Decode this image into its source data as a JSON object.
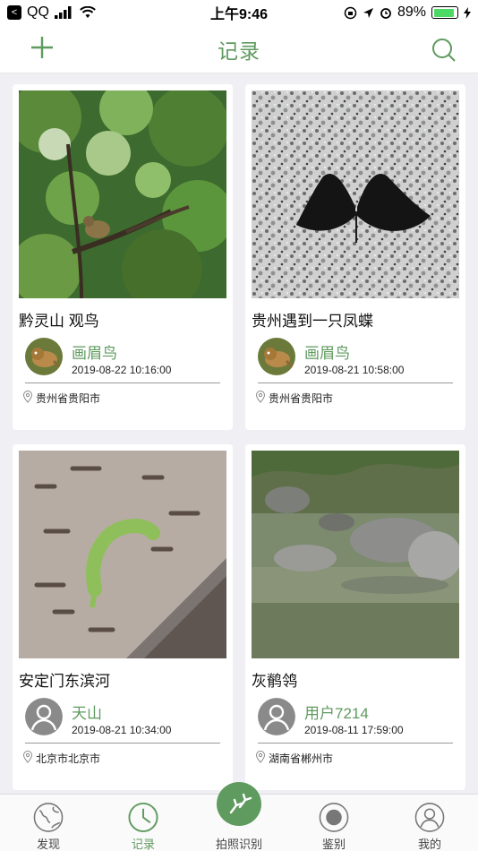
{
  "status_bar": {
    "back_label": "<",
    "app": "QQ",
    "time": "上午9:46",
    "battery": "89%",
    "battery_level": 0.89
  },
  "header": {
    "title": "记录",
    "add_icon": "plus-icon",
    "search_icon": "search-icon"
  },
  "records": [
    {
      "title": "黔灵山 观鸟",
      "user": "画眉鸟",
      "time": "2019-08-22 10:16:00",
      "location": "贵州省贵阳市",
      "image": "bird-in-tree",
      "avatar": "bird"
    },
    {
      "title": "贵州遇到一只凤蝶",
      "user": "画眉鸟",
      "time": "2019-08-21 10:58:00",
      "location": "贵州省贵阳市",
      "image": "butterfly-on-granite",
      "avatar": "bird"
    },
    {
      "title": "安定门东滨河",
      "user": "天山",
      "time": "2019-08-21 10:34:00",
      "location": "北京市北京市",
      "image": "caterpillar-on-bark",
      "avatar": "default-user"
    },
    {
      "title": "灰鹡鸰",
      "user": "用户7214",
      "time": "2019-08-11 17:59:00",
      "location": "湖南省郴州市",
      "image": "stream-rocks",
      "avatar": "default-user"
    }
  ],
  "tabs": [
    {
      "label": "发现",
      "icon": "globe-icon"
    },
    {
      "label": "记录",
      "icon": "clock-icon"
    },
    {
      "label": "拍照识别",
      "icon": "camera-tracks-icon"
    },
    {
      "label": "鉴别",
      "icon": "record-dot-icon"
    },
    {
      "label": "我的",
      "icon": "user-icon"
    }
  ],
  "colors": {
    "accent": "#5f9a5f",
    "background": "#efeff4"
  }
}
